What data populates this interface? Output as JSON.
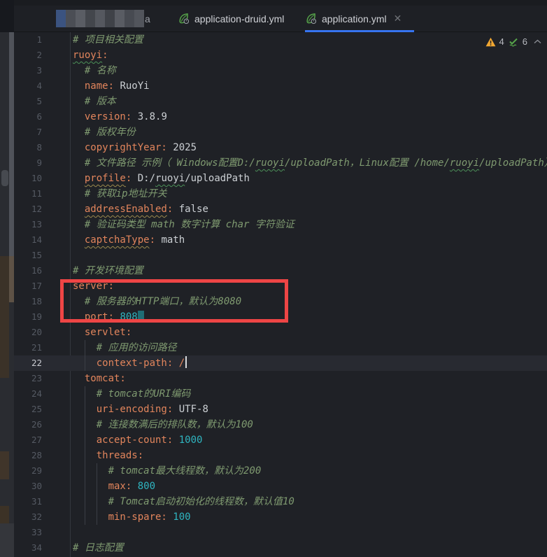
{
  "tab_bar": {
    "tabs": [
      {
        "id": "redacted",
        "redacted": true,
        "visible_suffix": "a",
        "mosaic_colors": [
          "#3b5380",
          "#4b4e55",
          "#5a5d64",
          "#43464c",
          "#55585f",
          "#3f4248",
          "#595c63",
          "#474a51",
          "#52555c"
        ]
      },
      {
        "id": "application-druid",
        "label": "application-druid.yml",
        "icon": "spring-boot-leaf-icon",
        "active": false
      },
      {
        "id": "application",
        "label": "application.yml",
        "icon": "spring-boot-leaf-icon",
        "active": true,
        "close_glyph": "✕"
      }
    ],
    "active_underline_color": "#3674f0"
  },
  "inspection_widget": {
    "warning_count": "4",
    "typo_ok_count": "6",
    "warning_color": "#f0a732",
    "ok_color": "#57a64a"
  },
  "annotation": {
    "type": "red-box",
    "covers_lines": "17-19",
    "color": "#ee4545"
  },
  "editor": {
    "language": "yaml",
    "current_line": 22,
    "lines": [
      {
        "n": 1,
        "s": [
          {
            "c": "cm",
            "t": "# 项目相关配置"
          }
        ]
      },
      {
        "n": 2,
        "s": [
          {
            "c": "k wg ul",
            "t": "ruoyi"
          },
          {
            "c": "k",
            "t": ":"
          }
        ]
      },
      {
        "n": 3,
        "s": [
          {
            "c": "p",
            "t": "  "
          },
          {
            "c": "cm",
            "t": "# 名称"
          }
        ]
      },
      {
        "n": 4,
        "s": [
          {
            "c": "p",
            "t": "  "
          },
          {
            "c": "k",
            "t": "name:"
          },
          {
            "c": "v",
            "t": " RuoYi"
          }
        ]
      },
      {
        "n": 5,
        "s": [
          {
            "c": "p",
            "t": "  "
          },
          {
            "c": "cm",
            "t": "# 版本"
          }
        ]
      },
      {
        "n": 6,
        "s": [
          {
            "c": "p",
            "t": "  "
          },
          {
            "c": "k",
            "t": "version:"
          },
          {
            "c": "v",
            "t": " 3.8.9"
          }
        ]
      },
      {
        "n": 7,
        "s": [
          {
            "c": "p",
            "t": "  "
          },
          {
            "c": "cm",
            "t": "# 版权年份"
          }
        ]
      },
      {
        "n": 8,
        "s": [
          {
            "c": "p",
            "t": "  "
          },
          {
            "c": "k",
            "t": "copyrightYear:"
          },
          {
            "c": "v",
            "t": " 2025"
          }
        ]
      },
      {
        "n": 9,
        "s": [
          {
            "c": "p",
            "t": "  "
          },
          {
            "c": "cm",
            "t": "# 文件路径 示例（ Windows配置D:/"
          },
          {
            "c": "cm wg",
            "t": "ruoyi"
          },
          {
            "c": "cm",
            "t": "/uploadPath，Linux配置 /home/"
          },
          {
            "c": "cm wg",
            "t": "ruoyi"
          },
          {
            "c": "cm",
            "t": "/uploadPath）"
          }
        ]
      },
      {
        "n": 10,
        "s": [
          {
            "c": "p",
            "t": "  "
          },
          {
            "c": "k wy",
            "t": "profile"
          },
          {
            "c": "k",
            "t": ":"
          },
          {
            "c": "v",
            "t": " D:/"
          },
          {
            "c": "v wg",
            "t": "ruoyi"
          },
          {
            "c": "v",
            "t": "/uploadPath"
          }
        ]
      },
      {
        "n": 11,
        "s": [
          {
            "c": "p",
            "t": "  "
          },
          {
            "c": "cm",
            "t": "# 获取ip地址开关"
          }
        ]
      },
      {
        "n": 12,
        "s": [
          {
            "c": "p",
            "t": "  "
          },
          {
            "c": "k wy",
            "t": "addressEnabled"
          },
          {
            "c": "k",
            "t": ":"
          },
          {
            "c": "v",
            "t": " false"
          }
        ]
      },
      {
        "n": 13,
        "s": [
          {
            "c": "p",
            "t": "  "
          },
          {
            "c": "cm",
            "t": "# 验证码类型 math 数字计算 char 字符验证"
          }
        ]
      },
      {
        "n": 14,
        "s": [
          {
            "c": "p",
            "t": "  "
          },
          {
            "c": "k wy",
            "t": "captchaType"
          },
          {
            "c": "k",
            "t": ":"
          },
          {
            "c": "v",
            "t": " math"
          }
        ]
      },
      {
        "n": 15,
        "s": []
      },
      {
        "n": 16,
        "s": [
          {
            "c": "cm",
            "t": "# 开发环境配置"
          }
        ]
      },
      {
        "n": 17,
        "s": [
          {
            "c": "k",
            "t": "server:"
          }
        ]
      },
      {
        "n": 18,
        "s": [
          {
            "c": "p",
            "t": "  "
          },
          {
            "c": "cm",
            "t": "# 服务器的HTTP端口，默认为8080"
          }
        ]
      },
      {
        "n": 19,
        "s": [
          {
            "c": "p",
            "t": "  "
          },
          {
            "c": "k",
            "t": "port:"
          },
          {
            "c": "n",
            "t": " 808"
          },
          {
            "c": "cursor-block",
            "t": ""
          }
        ]
      },
      {
        "n": 20,
        "s": [
          {
            "c": "p",
            "t": "  "
          },
          {
            "c": "k",
            "t": "servlet:"
          }
        ]
      },
      {
        "n": 21,
        "s": [
          {
            "c": "p",
            "t": "    "
          },
          {
            "c": "cm",
            "t": "# 应用的访问路径"
          }
        ]
      },
      {
        "n": 22,
        "cur": true,
        "s": [
          {
            "c": "p",
            "t": "    "
          },
          {
            "c": "k",
            "t": "context-path:"
          },
          {
            "c": "k",
            "t": " /"
          },
          {
            "c": "caret",
            "t": ""
          }
        ]
      },
      {
        "n": 23,
        "s": [
          {
            "c": "p",
            "t": "  "
          },
          {
            "c": "k",
            "t": "tomcat:"
          }
        ]
      },
      {
        "n": 24,
        "s": [
          {
            "c": "p",
            "t": "    "
          },
          {
            "c": "cm",
            "t": "# tomcat的URI编码"
          }
        ]
      },
      {
        "n": 25,
        "s": [
          {
            "c": "p",
            "t": "    "
          },
          {
            "c": "k",
            "t": "uri-encoding:"
          },
          {
            "c": "v",
            "t": " UTF-8"
          }
        ]
      },
      {
        "n": 26,
        "s": [
          {
            "c": "p",
            "t": "    "
          },
          {
            "c": "cm",
            "t": "# 连接数满后的排队数，默认为100"
          }
        ]
      },
      {
        "n": 27,
        "s": [
          {
            "c": "p",
            "t": "    "
          },
          {
            "c": "k",
            "t": "accept-count:"
          },
          {
            "c": "n",
            "t": " 1000"
          }
        ]
      },
      {
        "n": 28,
        "s": [
          {
            "c": "p",
            "t": "    "
          },
          {
            "c": "k",
            "t": "threads:"
          }
        ]
      },
      {
        "n": 29,
        "s": [
          {
            "c": "p",
            "t": "      "
          },
          {
            "c": "cm",
            "t": "# tomcat最大线程数，默认为200"
          }
        ]
      },
      {
        "n": 30,
        "s": [
          {
            "c": "p",
            "t": "      "
          },
          {
            "c": "k",
            "t": "max:"
          },
          {
            "c": "n",
            "t": " 800"
          }
        ]
      },
      {
        "n": 31,
        "s": [
          {
            "c": "p",
            "t": "      "
          },
          {
            "c": "cm",
            "t": "# Tomcat启动初始化的线程数，默认值10"
          }
        ]
      },
      {
        "n": 32,
        "s": [
          {
            "c": "p",
            "t": "      "
          },
          {
            "c": "k",
            "t": "min-spare:"
          },
          {
            "c": "n",
            "t": " 100"
          }
        ]
      },
      {
        "n": 33,
        "s": []
      },
      {
        "n": 34,
        "s": [
          {
            "c": "cm",
            "t": "# 日志配置"
          }
        ]
      }
    ],
    "theme_colors": {
      "editor_bg": "#1f2126",
      "current_line_bg": "#282a31",
      "key": "#e2855c",
      "value": "#ccd0d4",
      "number": "#2fb5c0",
      "comment": "#7f9a70",
      "line_number": "#555a63"
    }
  }
}
